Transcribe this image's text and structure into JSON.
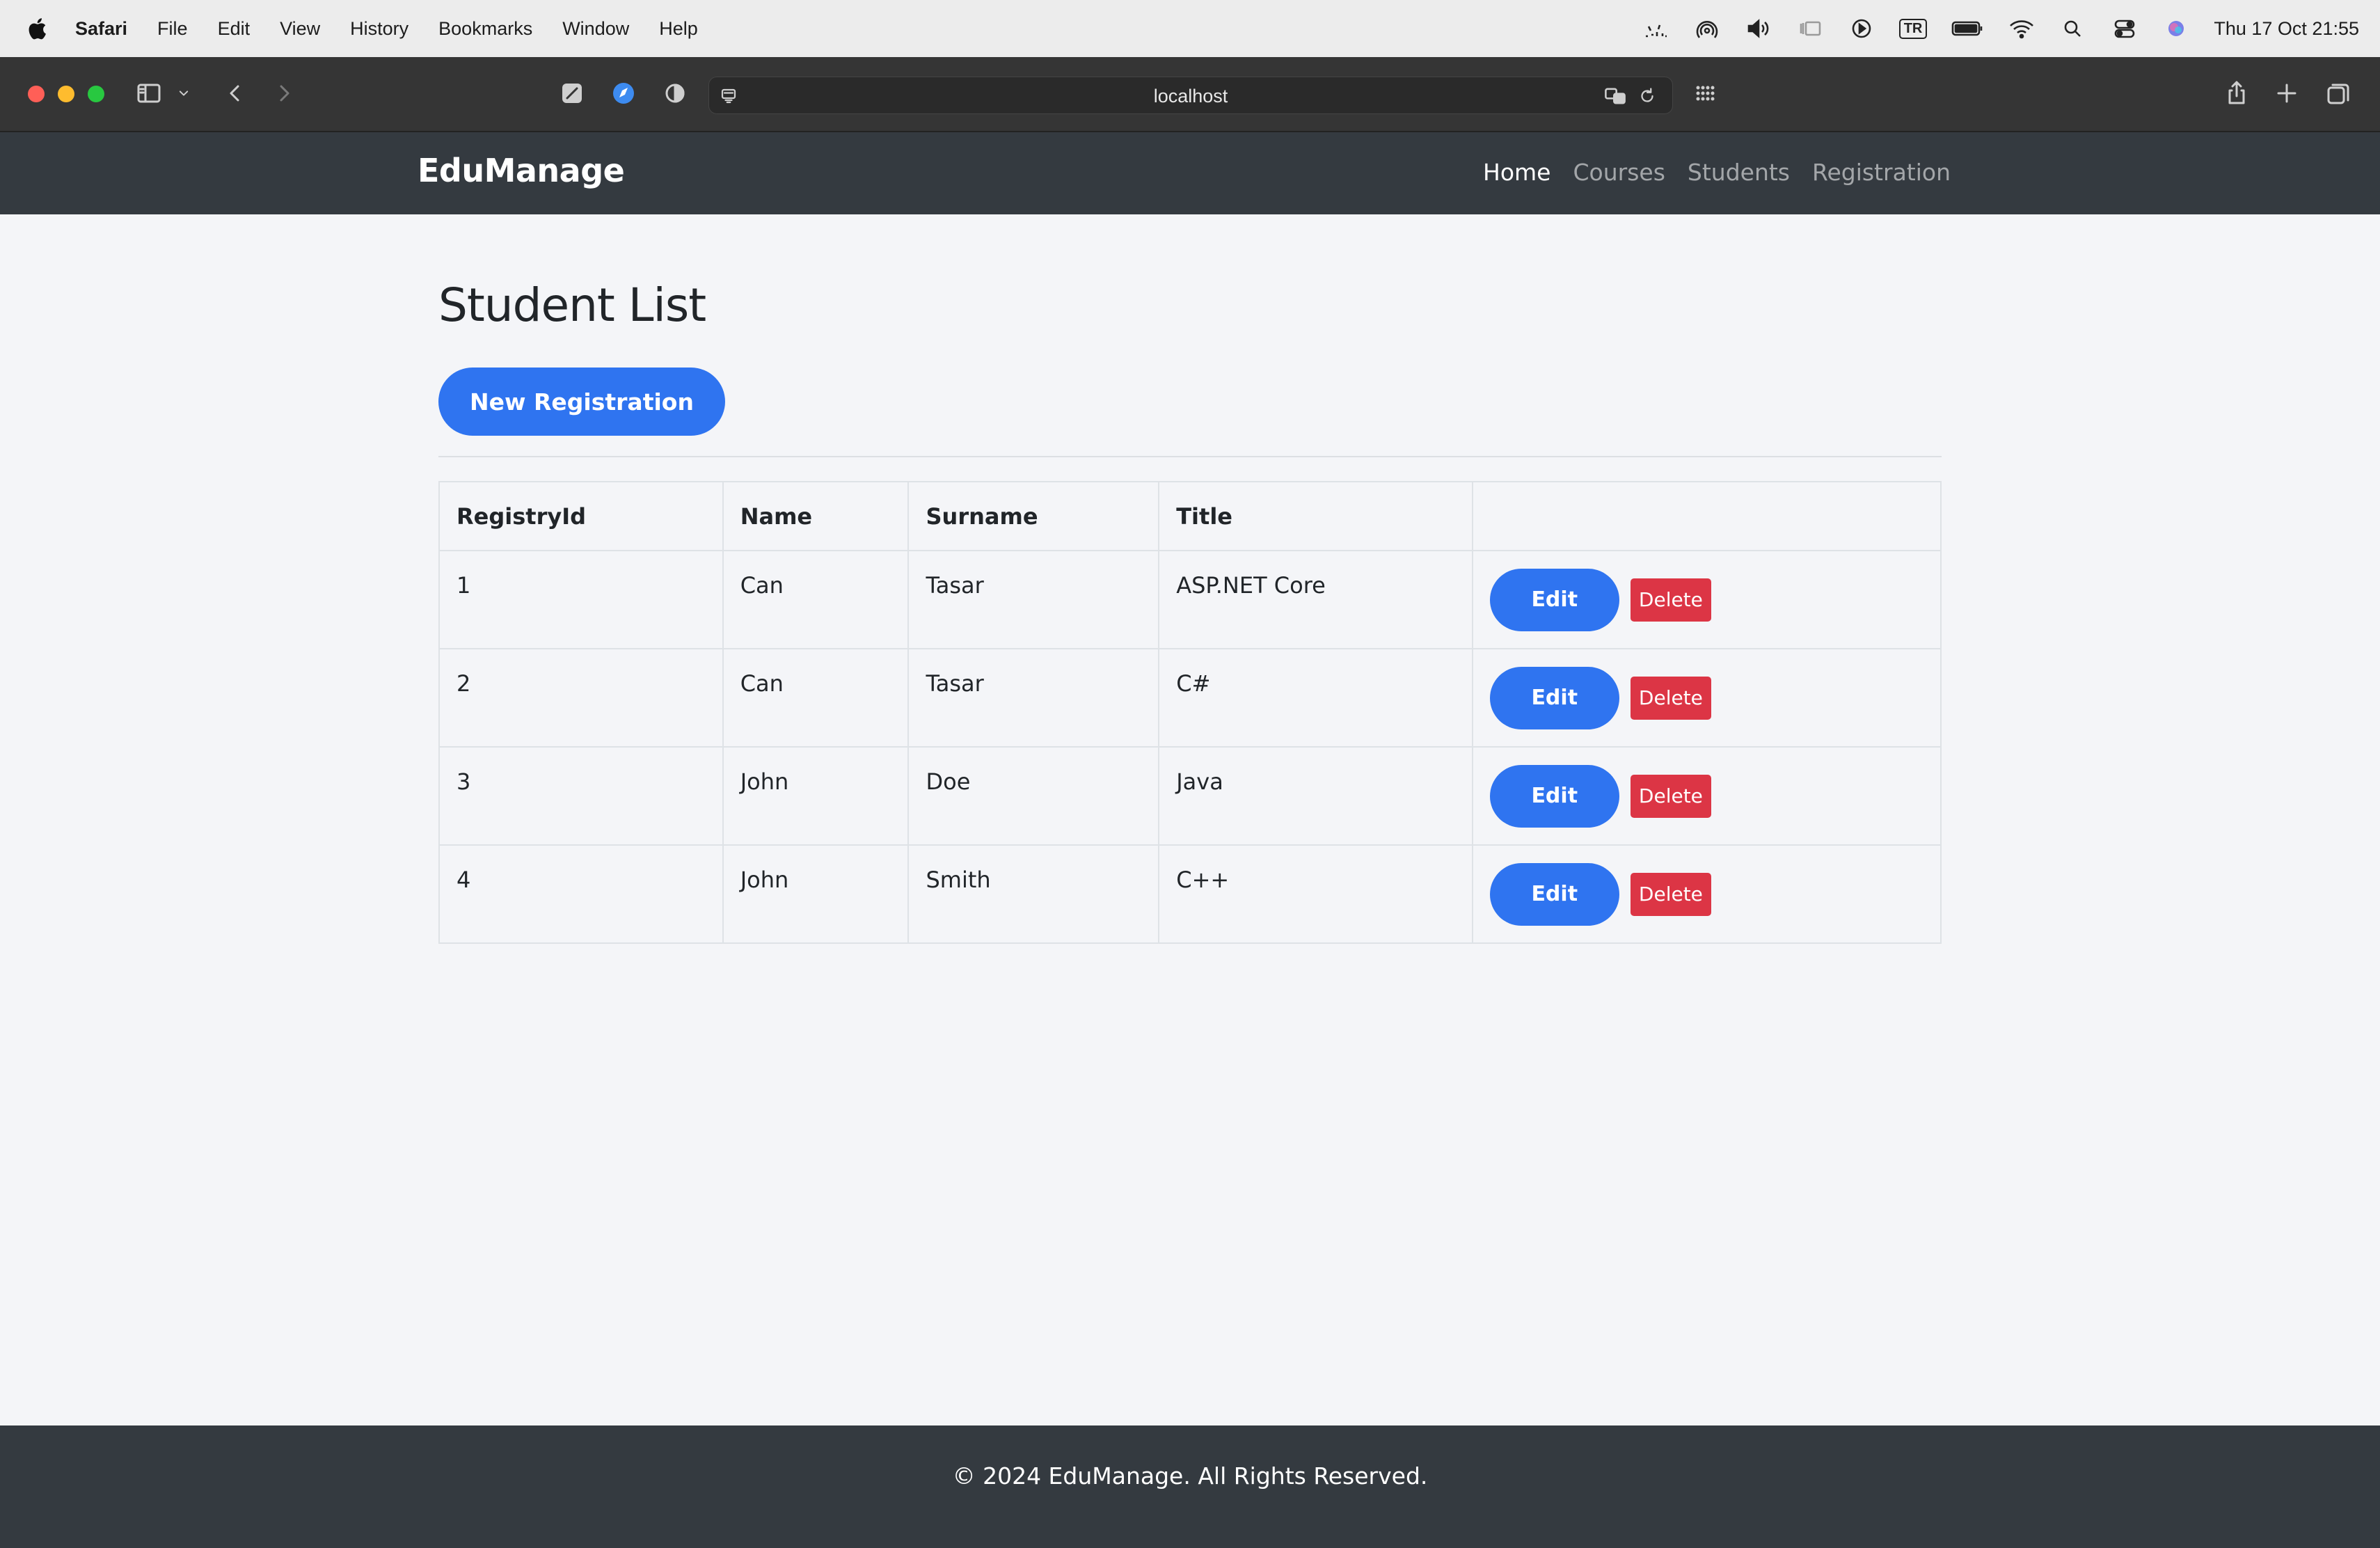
{
  "menubar": {
    "app": "Safari",
    "items": [
      "File",
      "Edit",
      "View",
      "History",
      "Bookmarks",
      "Window",
      "Help"
    ],
    "input_indicator": "TR",
    "clock": "Thu 17 Oct  21:55"
  },
  "browser": {
    "url": "localhost"
  },
  "navbar": {
    "brand": "EduManage",
    "links": [
      "Home",
      "Courses",
      "Students",
      "Registration"
    ]
  },
  "main": {
    "title": "Student List",
    "new_button": "New Registration",
    "table": {
      "headers": [
        "RegistryId",
        "Name",
        "Surname",
        "Title",
        ""
      ],
      "rows": [
        {
          "id": "1",
          "name": "Can",
          "surname": "Tasar",
          "title": "ASP.NET Core",
          "edit": "Edit",
          "delete": "Delete"
        },
        {
          "id": "2",
          "name": "Can",
          "surname": "Tasar",
          "title": "C#",
          "edit": "Edit",
          "delete": "Delete"
        },
        {
          "id": "3",
          "name": "John",
          "surname": "Doe",
          "title": "Java",
          "edit": "Edit",
          "delete": "Delete"
        },
        {
          "id": "4",
          "name": "John",
          "surname": "Smith",
          "title": "C++",
          "edit": "Edit",
          "delete": "Delete"
        }
      ]
    }
  },
  "footer": {
    "text": "© 2024 EduManage. All Rights Reserved."
  },
  "colors": {
    "primary": "#2f74f0",
    "danger": "#dc3545",
    "navbar": "#343a40",
    "page_background": "#f4f5f8"
  }
}
